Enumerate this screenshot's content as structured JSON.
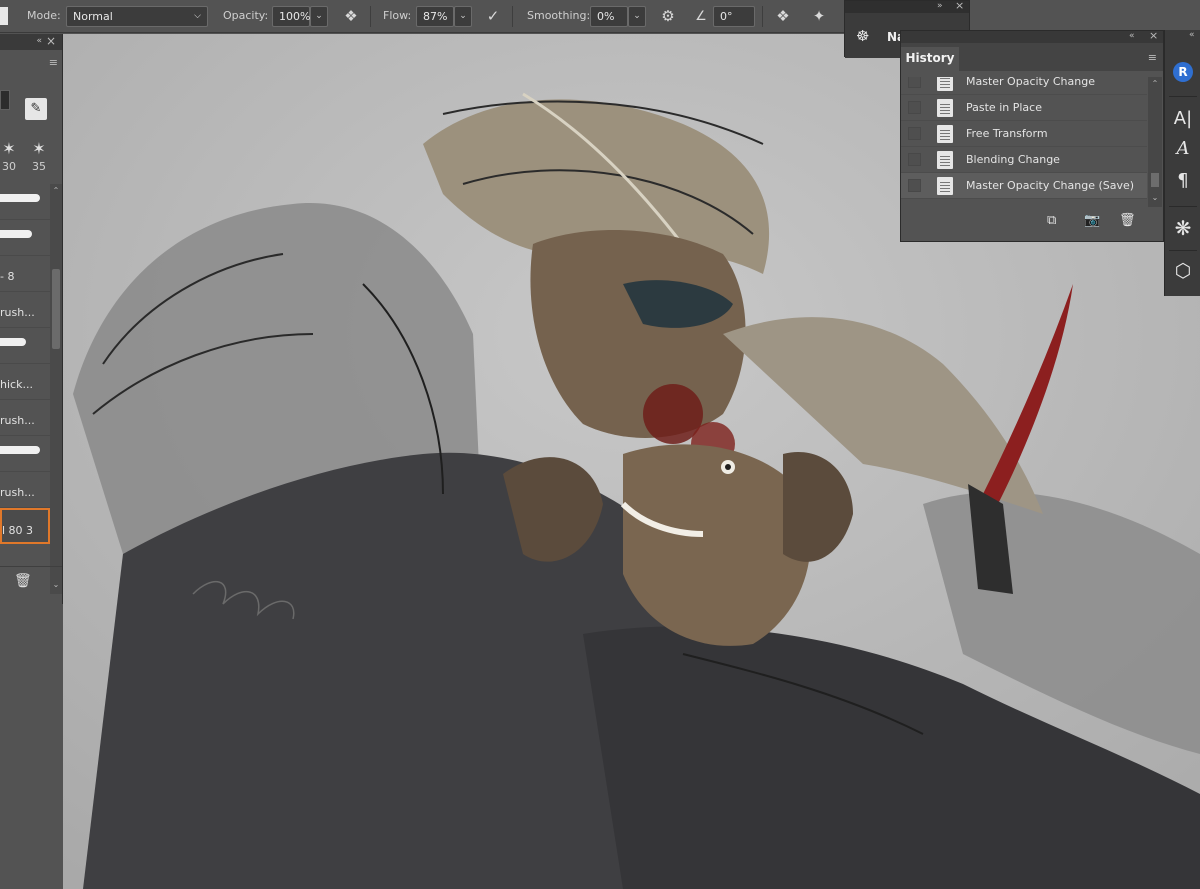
{
  "options_bar": {
    "mode_label": "Mode:",
    "mode_value": "Normal",
    "opacity_label": "Opacity:",
    "opacity_value": "100%",
    "flow_label": "Flow:",
    "flow_value": "87%",
    "smoothing_label": "Smoothing:",
    "smoothing_value": "0%",
    "angle_value": "0°"
  },
  "brush_panel": {
    "preset_sizes": [
      "30",
      "35"
    ],
    "brushes": [
      {
        "label": "",
        "stroke": 40
      },
      {
        "label": "",
        "stroke": 32
      },
      {
        "label": "- 8",
        "stroke": 0
      },
      {
        "label": "rush...",
        "stroke": 0
      },
      {
        "label": "",
        "stroke": 26
      },
      {
        "label": "hick...",
        "stroke": 0
      },
      {
        "label": "rush...",
        "stroke": 0
      },
      {
        "label": "",
        "stroke": 40
      },
      {
        "label": "rush...",
        "stroke": 0
      },
      {
        "label": "l 80 3",
        "stroke": 0
      }
    ]
  },
  "navigator": {
    "label": "Navigator",
    "icon": "ship-wheel-icon"
  },
  "history": {
    "tab_label": "History",
    "items": [
      {
        "label": "Master Opacity Change"
      },
      {
        "label": "Paste in Place"
      },
      {
        "label": "Free Transform"
      },
      {
        "label": "Blending Change"
      },
      {
        "label": "Master Opacity Change (Save)"
      }
    ]
  },
  "right_strip": {
    "icons": [
      "libraries-icon",
      "character-icon",
      "glyphs-icon",
      "paragraph-icon",
      "brush-settings-icon",
      "3d-icon"
    ]
  },
  "colors": {
    "panel_bg": "#535353",
    "canvas_bg": "#bdbdbd",
    "selection_accent": "#e0782a",
    "libraries_blue": "#2f6fd1"
  }
}
